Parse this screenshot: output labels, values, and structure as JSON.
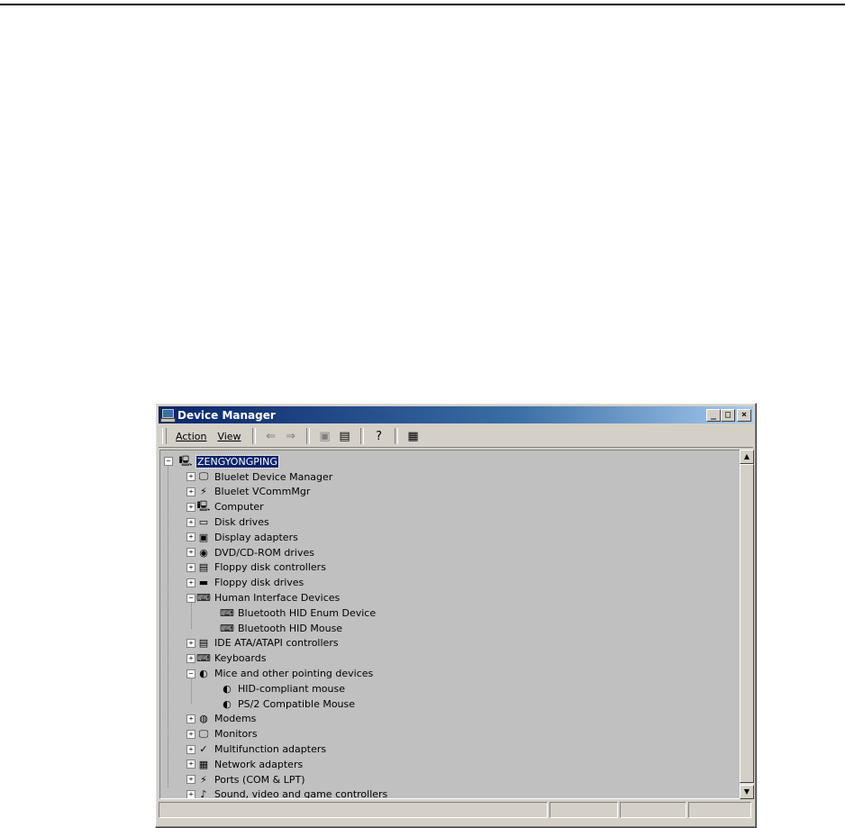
{
  "window": {
    "title": "Device Manager",
    "minimize": "_",
    "maximize": "□",
    "close": "×"
  },
  "toolbar": {
    "action_label": "Action",
    "view_label": "View"
  },
  "tree": {
    "root": "ZENGYONGPING",
    "items": [
      {
        "label": "Bluelet Device Manager",
        "level": 1,
        "expanded": false,
        "icon": "monitor-icon"
      },
      {
        "label": "Bluelet VCommMgr",
        "level": 1,
        "expanded": false,
        "icon": "port-icon"
      },
      {
        "label": "Computer",
        "level": 1,
        "expanded": false,
        "icon": "computer-icon"
      },
      {
        "label": "Disk drives",
        "level": 1,
        "expanded": false,
        "icon": "disk-icon"
      },
      {
        "label": "Display adapters",
        "level": 1,
        "expanded": false,
        "icon": "display-icon"
      },
      {
        "label": "DVD/CD-ROM drives",
        "level": 1,
        "expanded": false,
        "icon": "cdrom-icon"
      },
      {
        "label": "Floppy disk controllers",
        "level": 1,
        "expanded": false,
        "icon": "controller-icon"
      },
      {
        "label": "Floppy disk drives",
        "level": 1,
        "expanded": false,
        "icon": "floppy-icon"
      },
      {
        "label": "Human Interface Devices",
        "level": 1,
        "expanded": true,
        "icon": "hid-icon"
      },
      {
        "label": "Bluetooth HID Enum Device",
        "level": 2,
        "icon": "hid-icon"
      },
      {
        "label": "Bluetooth HID Mouse",
        "level": 2,
        "icon": "hid-icon"
      },
      {
        "label": "IDE ATA/ATAPI controllers",
        "level": 1,
        "expanded": false,
        "icon": "controller-icon"
      },
      {
        "label": "Keyboards",
        "level": 1,
        "expanded": false,
        "icon": "keyboard-icon"
      },
      {
        "label": "Mice and other pointing devices",
        "level": 1,
        "expanded": true,
        "icon": "mouse-icon"
      },
      {
        "label": "HID-compliant mouse",
        "level": 2,
        "icon": "mouse-icon"
      },
      {
        "label": "PS/2 Compatible Mouse",
        "level": 2,
        "icon": "mouse-icon"
      },
      {
        "label": "Modems",
        "level": 1,
        "expanded": false,
        "icon": "modem-icon"
      },
      {
        "label": "Monitors",
        "level": 1,
        "expanded": false,
        "icon": "monitor-icon"
      },
      {
        "label": "Multifunction adapters",
        "level": 1,
        "expanded": false,
        "icon": "multifunction-icon"
      },
      {
        "label": "Network adapters",
        "level": 1,
        "expanded": false,
        "icon": "network-icon"
      },
      {
        "label": "Ports (COM & LPT)",
        "level": 1,
        "expanded": false,
        "icon": "port-icon"
      },
      {
        "label": "Sound, video and game controllers",
        "level": 1,
        "expanded": false,
        "icon": "sound-icon"
      }
    ]
  },
  "colors": {
    "selection": "#0a246a",
    "title_start": "#0a246a",
    "title_end": "#a6caf0",
    "face": "#d4d0c8"
  }
}
